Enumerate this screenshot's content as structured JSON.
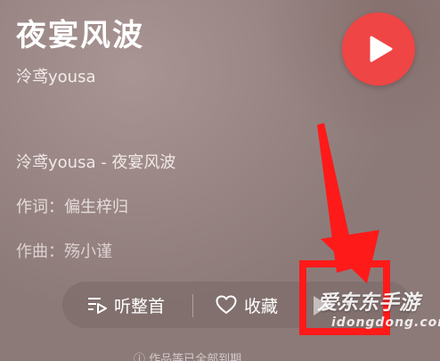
{
  "song": {
    "title": "夜宴风波",
    "artist": "泠鸢yousa"
  },
  "info": {
    "line1": "泠鸢yousa - 夜宴风波",
    "line2": "作词：偏生梓归",
    "line3": "作曲：殇小谨"
  },
  "actions": {
    "listen_label": "听整首",
    "favorite_label": "收藏",
    "more_label": "···"
  },
  "watermark": {
    "main": "爱东东手游",
    "sub": "idongdong.com"
  },
  "footer": {
    "text": "ⓘ 作品等已全部到期"
  },
  "colors": {
    "play": "#ef4545",
    "annotation": "#ff1a1a",
    "background": "#9b8886"
  },
  "icons": {
    "play": "play-icon",
    "listen": "playlist-play-icon",
    "favorite": "heart-icon",
    "more": "more-dots-icon"
  }
}
